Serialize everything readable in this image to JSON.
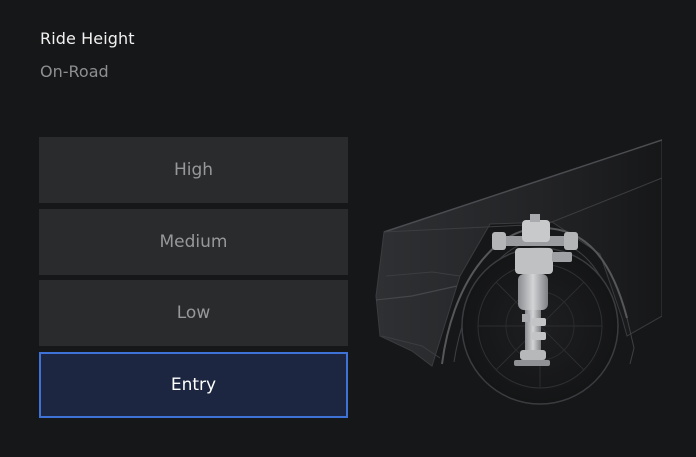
{
  "header": {
    "title": "Ride Height",
    "mode": "On-Road"
  },
  "ride_height": {
    "options": [
      {
        "label": "High",
        "selected": false
      },
      {
        "label": "Medium",
        "selected": false
      },
      {
        "label": "Low",
        "selected": false
      },
      {
        "label": "Entry",
        "selected": true
      }
    ]
  },
  "colors": {
    "background": "#161718",
    "option_bg": "#2a2b2d",
    "selected_bg": "#1c2640",
    "selected_border": "#3f72d6"
  },
  "illustration": {
    "icon": "vehicle-suspension-render"
  }
}
